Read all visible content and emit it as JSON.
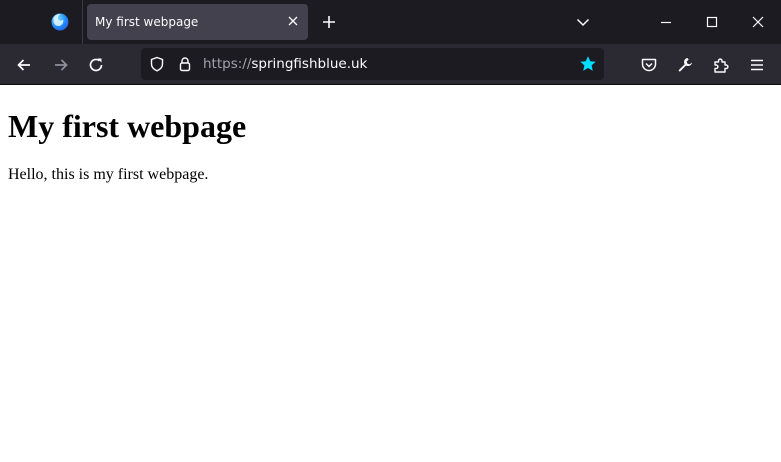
{
  "browser": {
    "tab": {
      "title": "My first webpage"
    },
    "urlbar": {
      "scheme": "https://",
      "host": "springfishblue.uk"
    },
    "colors": {
      "titlebar": "#1c1b22",
      "toolbar": "#2b2a33",
      "active_tab": "#42414d",
      "bookmark_star": "#00ddff",
      "icon": "#fbfbfe"
    }
  },
  "page": {
    "heading": "My first webpage",
    "paragraph": "Hello, this is my first webpage."
  }
}
